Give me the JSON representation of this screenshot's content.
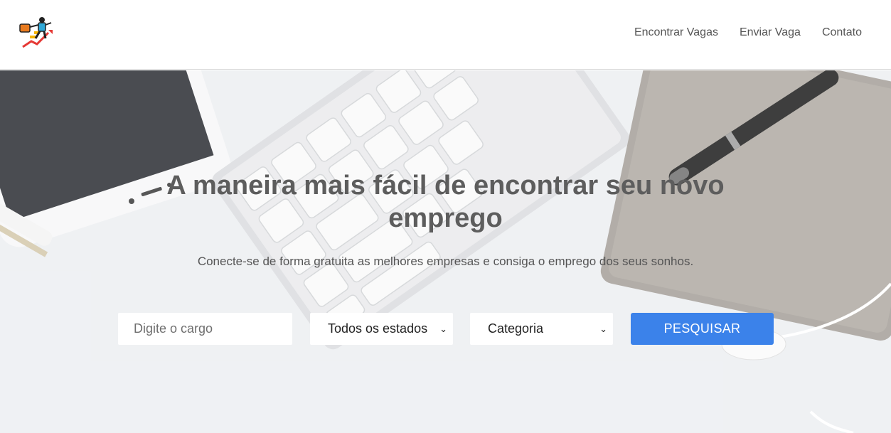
{
  "header": {
    "logo_icon": "job-climber-icon",
    "nav": [
      {
        "label": "Encontrar Vagas"
      },
      {
        "label": "Enviar Vaga"
      },
      {
        "label": "Contato"
      }
    ]
  },
  "hero": {
    "title": "A maneira mais fácil de encontrar seu novo emprego",
    "subtitle": "Conecte-se de forma gratuita as melhores empresas e consiga o emprego dos seus sonhos.",
    "search": {
      "placeholder": "Digite o cargo",
      "estado_selected": "Todos os estados",
      "categoria_selected": "Categoria",
      "button_label": "PESQUISAR"
    }
  },
  "colors": {
    "accent": "#3b82ea",
    "title": "#5d5d5d",
    "nav_text": "#555555"
  }
}
